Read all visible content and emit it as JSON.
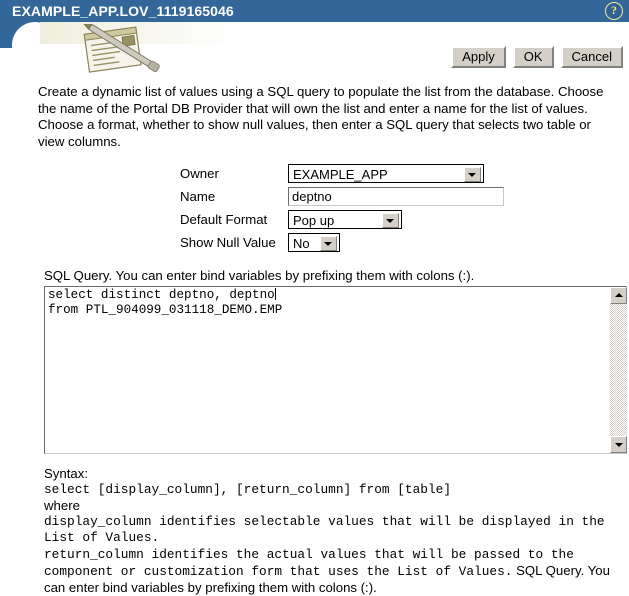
{
  "titlebar": {
    "title": "EXAMPLE_APP.LOV_1119165046",
    "help_icon": "question-mark-icon",
    "background_color": "#336699",
    "text_color": "#ffffff"
  },
  "toolbar": {
    "apply_label": "Apply",
    "ok_label": "OK",
    "cancel_label": "Cancel"
  },
  "logo": {
    "name": "notepad-and-pen-logo"
  },
  "description": "Create a dynamic list of values using a SQL query to populate the list from the database. Choose the name of the Portal DB Provider that will own the list and enter a name for the list of values. Choose a format, whether to show null values, then enter a SQL query that selects two table or view columns.",
  "form": {
    "owner": {
      "label": "Owner",
      "value": "EXAMPLE_APP"
    },
    "name": {
      "label": "Name",
      "value": "deptno",
      "placeholder": ""
    },
    "default_format": {
      "label": "Default Format",
      "value": "Pop up"
    },
    "show_null_value": {
      "label": "Show Null Value",
      "value": "No"
    }
  },
  "sql": {
    "label": "SQL Query. You can enter bind variables by prefixing them with colons (:).",
    "line1": "select distinct deptno, deptno",
    "line2": "from PTL_904099_031118_DEMO.EMP"
  },
  "syntax": {
    "heading": "Syntax:",
    "signature": "select [display_column], [return_column] from [table]",
    "where": "where",
    "display_column_desc": "display_column identifies selectable values that will be displayed in the List of Values.",
    "return_column_desc": "return_column identifies the actual values that will be passed to the component or customization form that uses the List of Values.",
    "trailing": "SQL Query. You can enter bind variables by prefixing them with colons (:)."
  }
}
